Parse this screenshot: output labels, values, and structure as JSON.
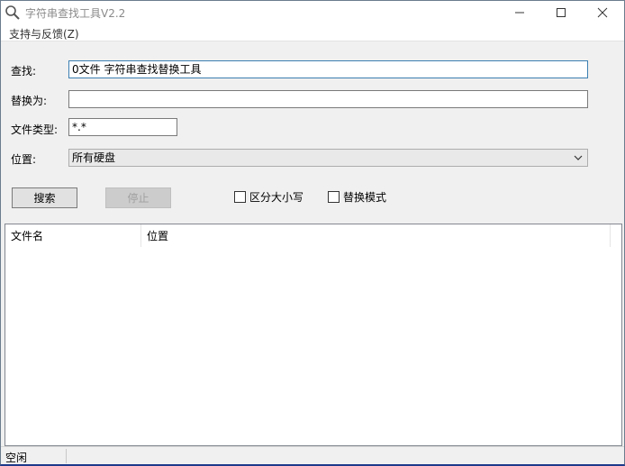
{
  "window": {
    "title": "字符串查找工具V2.2",
    "icon": "magnifier-icon",
    "controls": {
      "minimize": "minimize-icon",
      "maximize": "maximize-icon",
      "close": "close-icon"
    }
  },
  "menu": {
    "support_label": "支持与反馈(Z)"
  },
  "form": {
    "search_label": "查找:",
    "search_value": "0文件 字符串查找替换工具",
    "replace_label": "替换为:",
    "replace_value": "",
    "filetype_label": "文件类型:",
    "filetype_value": "*.*",
    "location_label": "位置:",
    "location_value": "所有硬盘"
  },
  "actions": {
    "search_label": "搜索",
    "stop_label": "停止",
    "case_label": "区分大小写",
    "case_checked": false,
    "replace_mode_label": "替换模式",
    "replace_mode_checked": false
  },
  "results": {
    "columns": [
      "文件名",
      "位置"
    ],
    "rows": []
  },
  "status": {
    "text": "空闲"
  },
  "colors": {
    "focus_border": "#3c7fb1",
    "disabled_text": "#a0a0a0",
    "window_bg": "#f0f0f0"
  }
}
